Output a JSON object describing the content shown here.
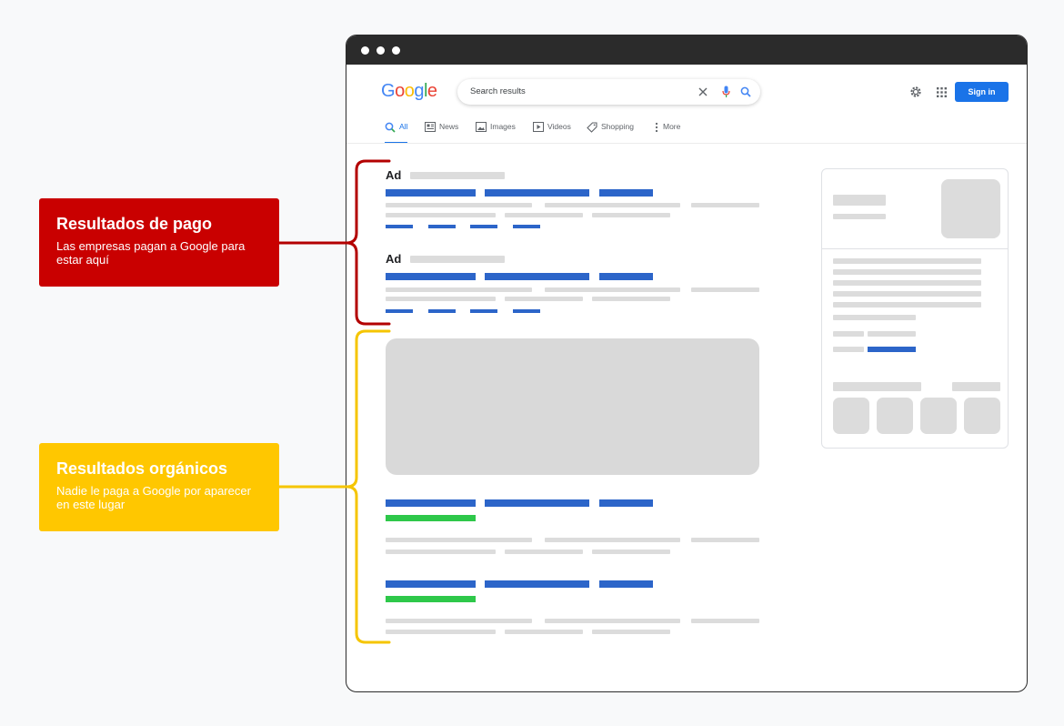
{
  "browser": {
    "logo": "Google",
    "search": {
      "value": "Search results",
      "placeholder": "Search results"
    },
    "sign_in_label": "Sign in",
    "tabs": [
      {
        "label": "All",
        "icon": "search-icon",
        "active": true
      },
      {
        "label": "News",
        "icon": "news-icon"
      },
      {
        "label": "Images",
        "icon": "image-icon"
      },
      {
        "label": "Videos",
        "icon": "video-icon"
      },
      {
        "label": "Shopping",
        "icon": "tag-icon"
      },
      {
        "label": "More",
        "icon": "more-vert-icon"
      }
    ],
    "ad_results": [
      {
        "label": "Ad"
      },
      {
        "label": "Ad"
      }
    ]
  },
  "callouts": {
    "paid": {
      "title": "Resultados de pago",
      "text": "Las empresas pagan a Google para estar aquí"
    },
    "organic": {
      "title": "Resultados orgánicos",
      "text": "Nadie le paga a Google por aparecer en este lugar"
    }
  },
  "colors": {
    "paid": "#c90000",
    "organic": "#ffc700",
    "link_placeholder": "#2c65c9",
    "url_placeholder": "#2ec84a",
    "text_placeholder": "#dcdcdc",
    "sign_in": "#1a73e8",
    "window_frame": "#2b2b2b"
  }
}
